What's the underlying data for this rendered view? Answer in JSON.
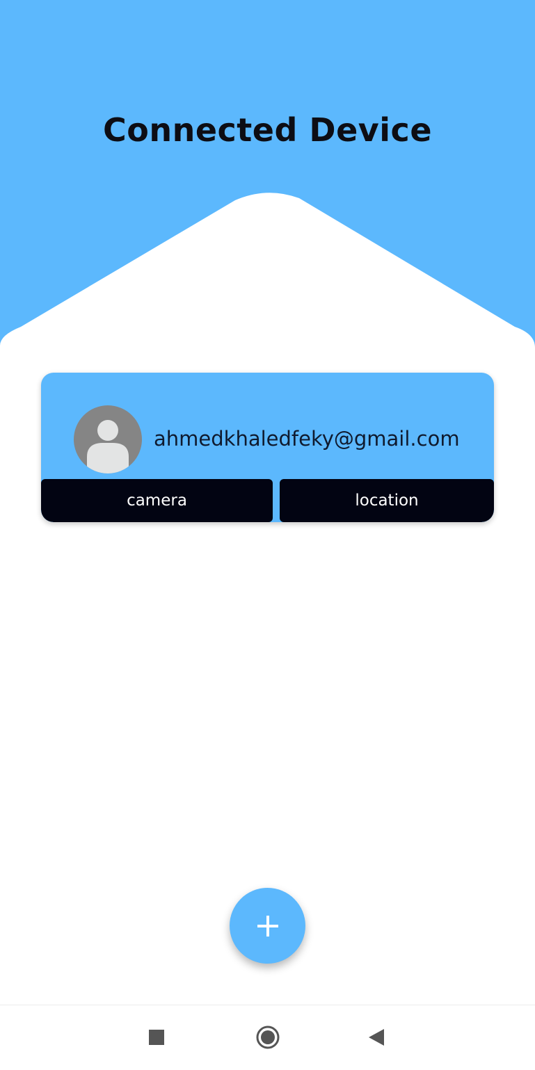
{
  "colors": {
    "primary_blue": "#5cb8fd",
    "button_dark": "#020412",
    "avatar_bg": "#858585",
    "avatar_fg": "#e3e4e4",
    "nav_icon": "#555555",
    "title_text": "#0d0d14"
  },
  "header": {
    "title": "Connected Device"
  },
  "device_card": {
    "email": "ahmedkhaledfeky@gmail.com",
    "avatar_icon": "person-placeholder-icon",
    "camera_label": "camera",
    "location_label": "location"
  },
  "fab": {
    "icon": "plus-icon"
  },
  "nav": {
    "recents_icon": "square-icon",
    "home_icon": "circle-icon",
    "back_icon": "triangle-left-icon"
  }
}
